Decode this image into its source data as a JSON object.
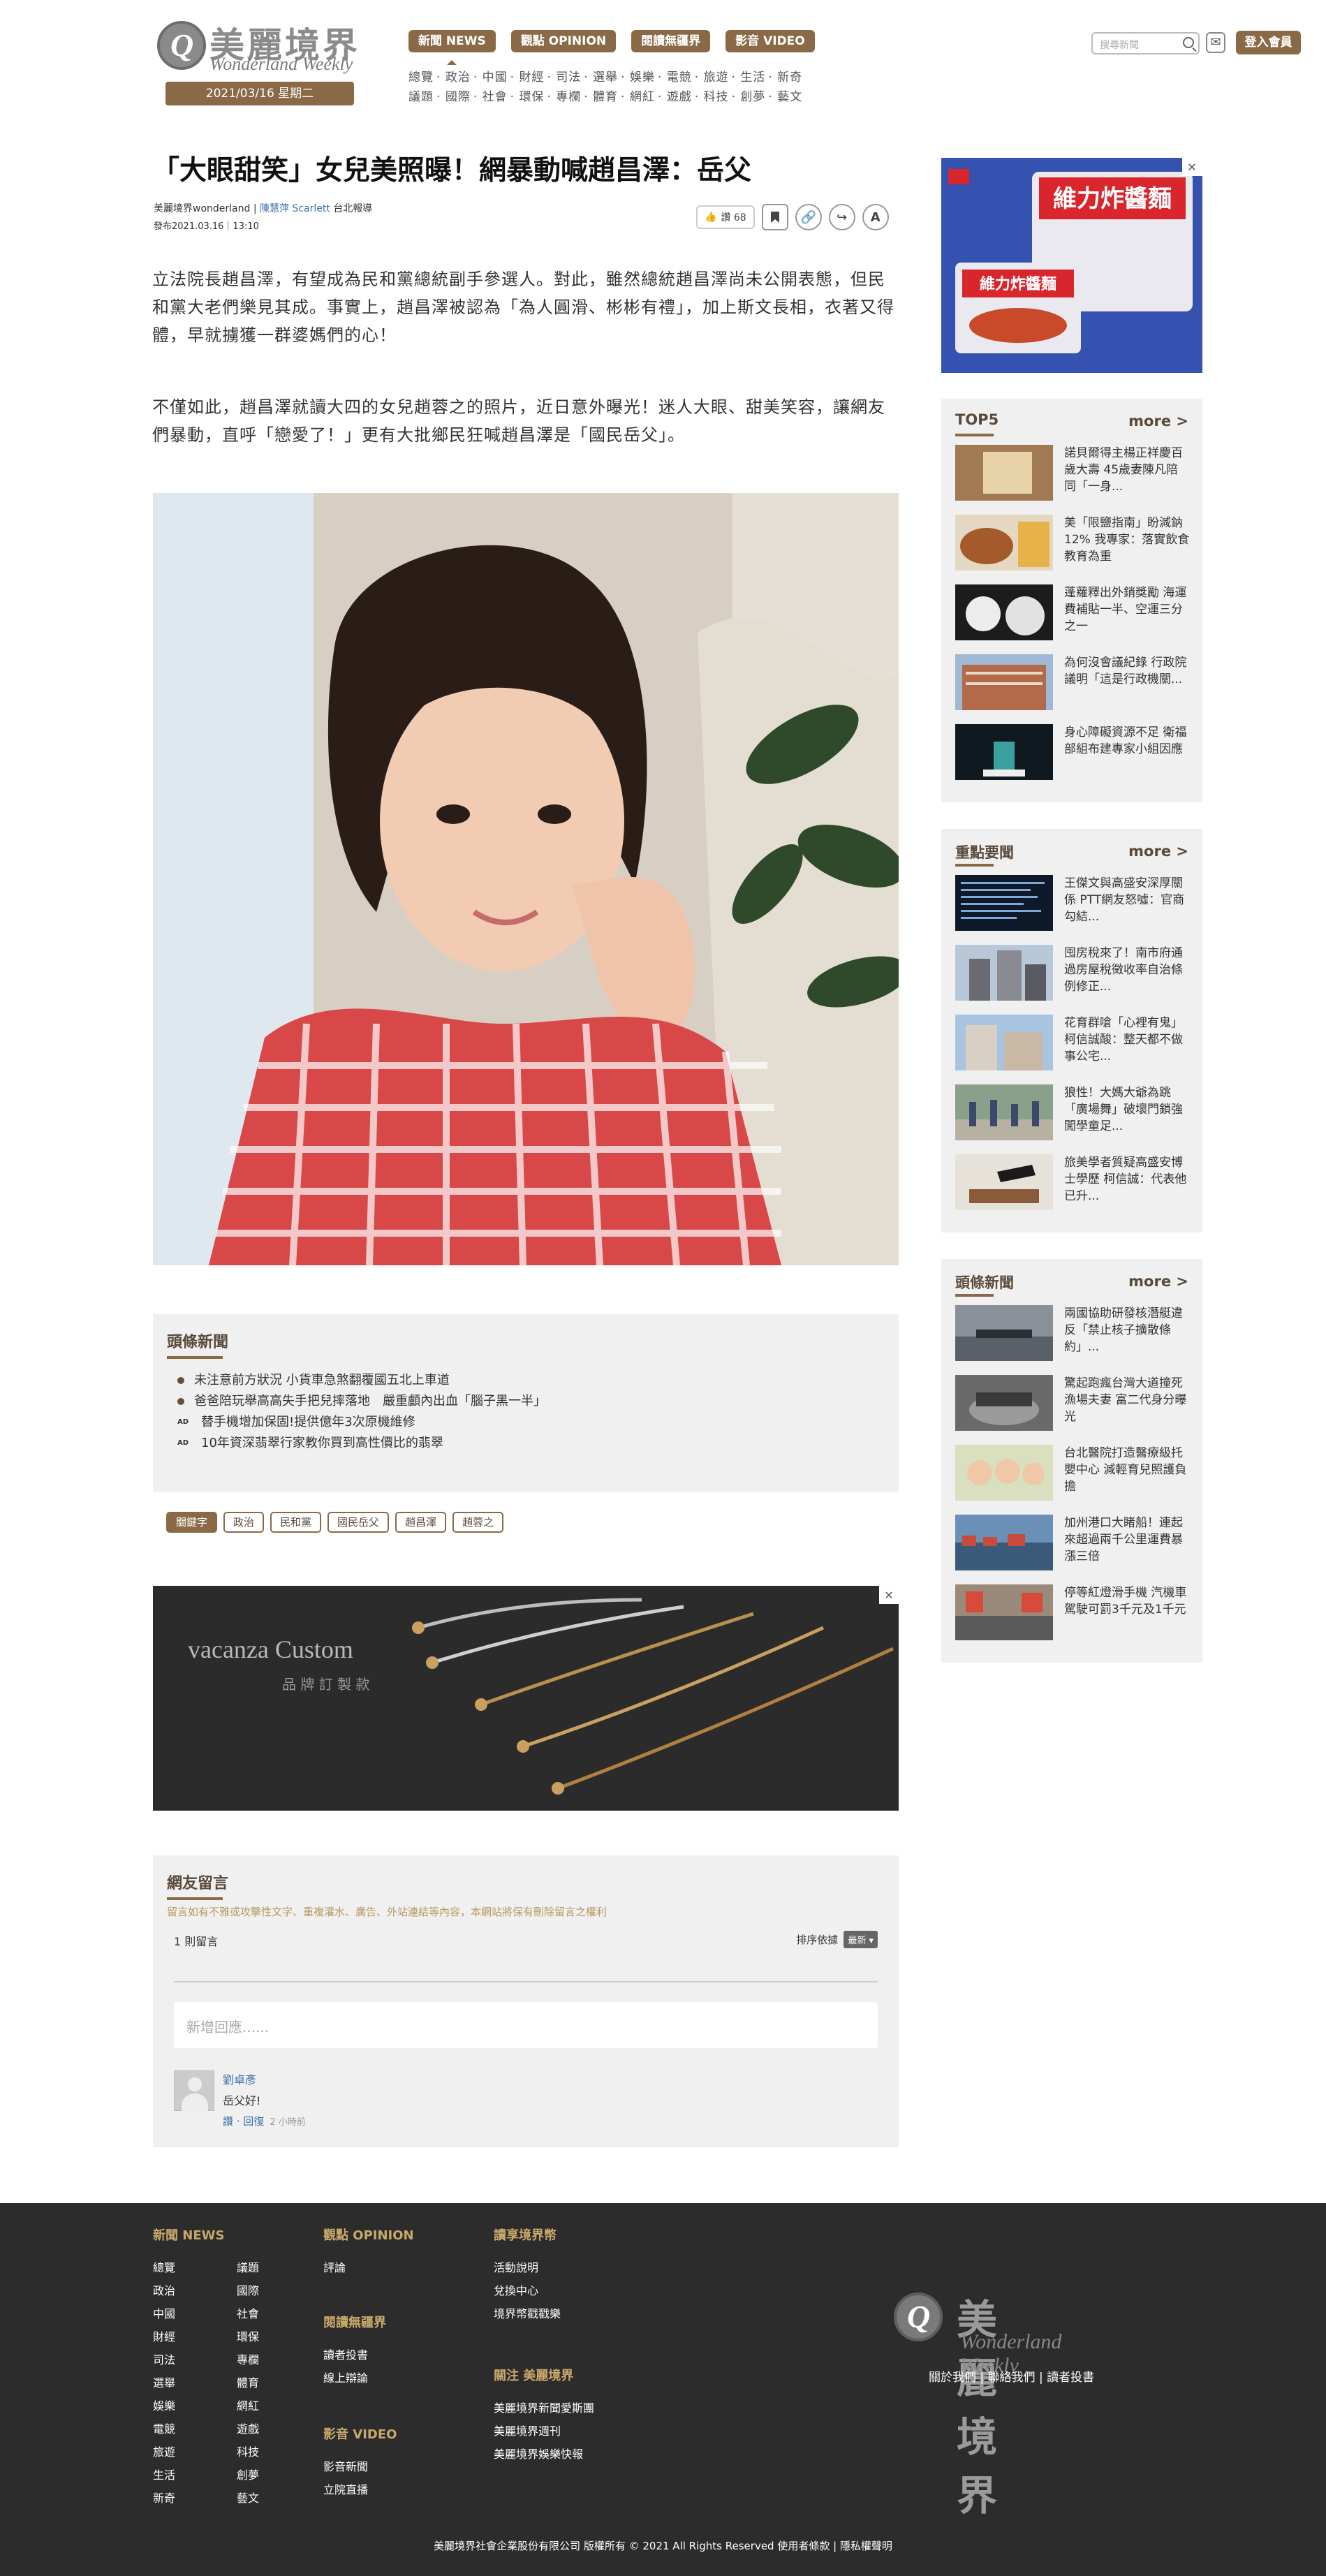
{
  "header": {
    "logo_cn": "美麗境界",
    "logo_en": "Wonderland Weekly",
    "date": "2021/03/16 星期二",
    "nav_pills": [
      "新聞 NEWS",
      "觀點 OPINION",
      "閱讀無疆界",
      "影音 VIDEO"
    ],
    "nav_row1": [
      "總覽",
      "政治",
      "中國",
      "財經",
      "司法",
      "選舉",
      "娛樂",
      "電競",
      "旅遊",
      "生活",
      "新奇"
    ],
    "nav_row2": [
      "議題",
      "國際",
      "社會",
      "環保",
      "專欄",
      "體育",
      "網紅",
      "遊戲",
      "科技",
      "創夢",
      "藝文"
    ],
    "search_placeholder": "搜尋新聞",
    "login": "登入會員"
  },
  "article": {
    "title": "「大眼甜笑」女兒美照曝！網暴動喊趙昌澤：岳父",
    "source": "美麗境界wonderland",
    "author": "陳慧萍 Scarlett",
    "location": "台北報導",
    "published": "發布2021.03.16｜13:10",
    "like_label": "讚 68",
    "para1": "立法院長趙昌澤，有望成為民和黨總統副手參選人。對此，雖然總統趙昌澤尚未公開表態，但民和黨大老們樂見其成。事實上，趙昌澤被認為「為人圓滑、彬彬有禮」，加上斯文長相，衣著又得體，早就擄獲一群婆媽們的心！",
    "para2": "不僅如此，趙昌澤就讀大四的女兒趙蓉之的照片，近日意外曝光！迷人大眼、甜美笑容，讓網友們暴動，直呼「戀愛了！」更有大批鄉民狂喊趙昌澤是「國民岳父」。"
  },
  "headlines": {
    "title": "頭條新聞",
    "items": [
      {
        "type": "dot",
        "text": "未注意前方狀況 小貨車急煞翻覆國五北上車道"
      },
      {
        "type": "dot",
        "text": "爸爸陪玩舉高高失手把兒摔落地　嚴重顱內出血「腦子黑一半」"
      },
      {
        "type": "ad",
        "text": "替手機增加保固!提供億年3次原機維修"
      },
      {
        "type": "ad",
        "text": "10年資深翡翠行家教你買到高性價比的翡翠"
      }
    ]
  },
  "tags": [
    "關鍵字",
    "政治",
    "民和黨",
    "國民岳父",
    "趙昌澤",
    "趙蓉之"
  ],
  "ad_banner": {
    "brand": "vacanza Custom",
    "sub": "品 牌 訂 製 款"
  },
  "comments": {
    "title": "網友留言",
    "notice": "留言如有不雅或攻擊性文字、重複灌水、廣告、外站連結等內容，本網站將保有刪除留言之權利",
    "count": "1 則留言",
    "sort_label": "排序依據",
    "sort_value": "最新",
    "input_placeholder": "新增回應......",
    "user": "劉卓彥",
    "text": "岳父好!",
    "actions": "讚 · 回復",
    "time": "2 小時前"
  },
  "sidebar": {
    "top5": {
      "title": "TOP5",
      "more": "more >",
      "items": [
        "諾貝爾得主楊正祥慶百歲大壽 45歲妻陳凡陪同「一身...",
        "美「限鹽指南」盼減鈉12% 我專家：落實飲食教育為重",
        "蓬蘿釋出外銷獎勵 海運費補貼一半、空運三分之一",
        "為何沒會議紀錄 行政院議明「這是行政機關...",
        "身心障礙資源不足 衛福部組布建專家小組因應"
      ]
    },
    "focus": {
      "title": "重點要聞",
      "more": "more >",
      "items": [
        "王傑文與高盛安深厚關係 PTT網友怒噓：官商勾結...",
        "囤房稅來了！南市府通過房屋稅徵收率自治條例修正...",
        "花育群嗆「心裡有鬼」柯信誠酸：整天都不做事公宅...",
        "狼性！大媽大爺為跳「廣場舞」破壞門鎖強闖學童足...",
        "旅美學者質疑高盛安博士學歷 柯信誠：代表他已升..."
      ]
    },
    "headlines": {
      "title": "頭條新聞",
      "more": "more >",
      "items": [
        "兩國協助研發核潛艇違反「禁止核子擴散條約」...",
        "驚起跑瘋台灣大道撞死漁場夫妻 富二代身分曝光",
        "台北醫院打造醫療級托嬰中心 減輕育兒照護負擔",
        "加州港口大睹船！連起來超過兩千公里運費暴漲三倍",
        "停等紅燈滑手機 汽機車駕駛可罰3千元及1千元"
      ]
    }
  },
  "footer": {
    "news_head": "新聞 NEWS",
    "news_links": [
      "總覽",
      "議題",
      "政治",
      "國際",
      "中國",
      "社會",
      "財經",
      "環保",
      "司法",
      "專欄",
      "選舉",
      "體育",
      "娛樂",
      "網紅",
      "電競",
      "遊戲",
      "旅遊",
      "科技",
      "生活",
      "創夢",
      "新奇",
      "藝文"
    ],
    "opinion_head": "觀點 OPINION",
    "opinion_links": [
      "評論"
    ],
    "read_head": "閱讀無疆界",
    "read_links": [
      "讀者投書",
      "線上辯論"
    ],
    "video_head": "影音 VIDEO",
    "video_links": [
      "影音新聞",
      "立院直播"
    ],
    "coin_head": "讀享境界幣",
    "coin_links": [
      "活動說明",
      "兌換中心",
      "境界幣戳戳樂"
    ],
    "follow_head": "關注 美麗境界",
    "follow_links": [
      "美麗境界新聞愛斯團",
      "美麗境界週刊",
      "美麗境界娛樂快報"
    ],
    "logo_cn": "美麗境界",
    "logo_en": "Wonderland Weekly",
    "bottom_links": "關於我們 | 聯絡我們 | 讀者投書",
    "copyright": "美麗境界社會企業股份有限公司  版權所有 © 2021 All Rights Reserved   使用者條款 | 隱私權聲明"
  }
}
